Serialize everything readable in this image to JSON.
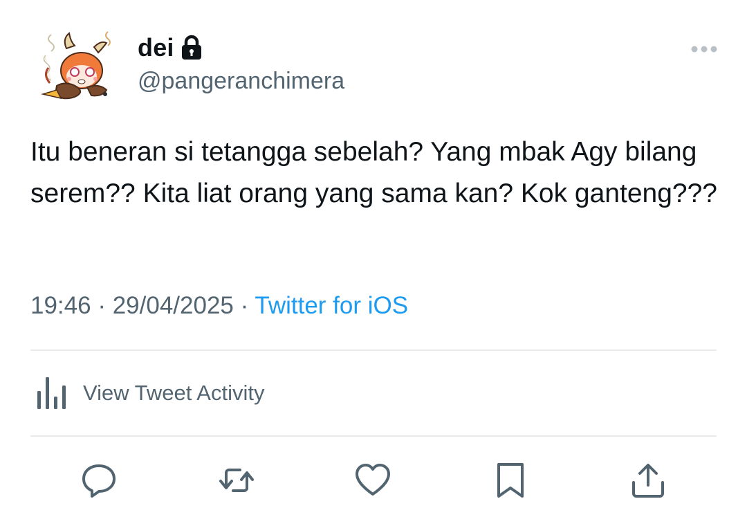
{
  "user": {
    "display_name": "dei",
    "handle": "@pangeranchimera",
    "verified_lock": "lock-icon"
  },
  "tweet": {
    "text": "Itu beneran si tetangga sebelah? Yang mbak Agy bilang serem?? Kita liat orang yang sama kan? Kok ganteng???",
    "time": "19:46",
    "date": "29/04/2025",
    "separator": "·",
    "source": "Twitter for iOS"
  },
  "activity": {
    "label": "View Tweet Activity",
    "icon": "bar-chart-icon"
  },
  "actions": {
    "reply_icon": "reply-icon",
    "retweet_icon": "retweet-icon",
    "like_icon": "like-icon",
    "bookmark_icon": "bookmark-icon",
    "share_icon": "share-icon"
  },
  "colors": {
    "text": "#0f1419",
    "secondary": "#536471",
    "link": "#1d9bf0",
    "divider": "#e7e9ea"
  }
}
